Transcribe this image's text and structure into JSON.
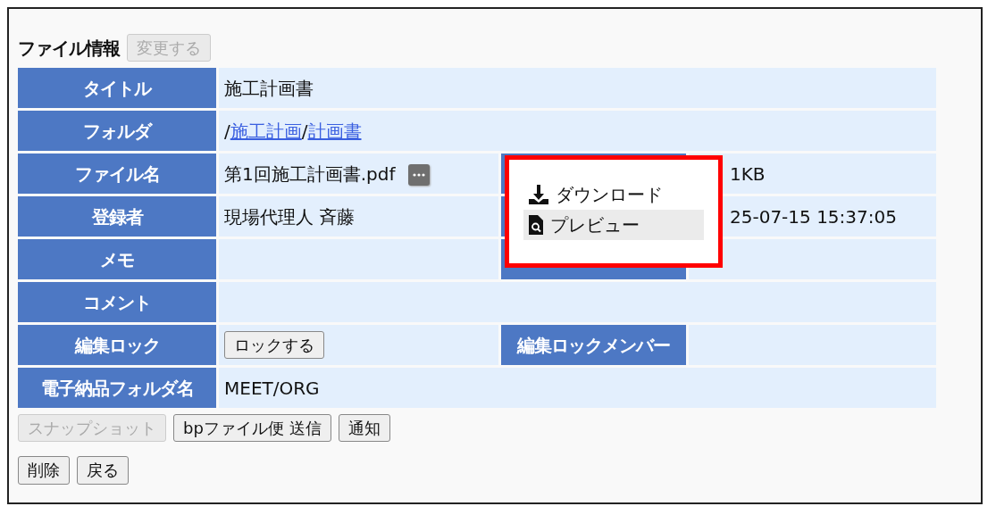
{
  "section": {
    "title": "ファイル情報",
    "edit_button": {
      "label": "変更する",
      "disabled": true
    }
  },
  "rows": [
    {
      "cells": [
        {
          "kind": "head",
          "text": "タイトル"
        },
        {
          "kind": "text",
          "text": "施工計画書"
        }
      ]
    },
    {
      "cells": [
        {
          "kind": "head",
          "text": "フォルダ"
        },
        {
          "kind": "links",
          "separator": "/",
          "links": [
            "施工計画",
            "計画書"
          ]
        }
      ]
    },
    {
      "cells": [
        {
          "kind": "head",
          "text": "ファイル名"
        },
        {
          "kind": "file",
          "text": "第1回施工計画書.pdf"
        },
        {
          "kind": "head"
        },
        {
          "kind": "text",
          "text": "1KB"
        }
      ]
    },
    {
      "cells": [
        {
          "kind": "head",
          "text": "登録者"
        },
        {
          "kind": "text",
          "text": "現場代理人 斉藤"
        },
        {
          "kind": "head"
        },
        {
          "kind": "text",
          "text": "25-07-15 15:37:05"
        }
      ]
    },
    {
      "cells": [
        {
          "kind": "head",
          "text": "メモ"
        },
        {
          "kind": "text"
        },
        {
          "kind": "head"
        },
        {
          "kind": "text"
        }
      ]
    },
    {
      "cells": [
        {
          "kind": "head",
          "text": "コメント"
        },
        {
          "kind": "text"
        }
      ]
    },
    {
      "cells": [
        {
          "kind": "head",
          "text": "編集ロック"
        },
        {
          "kind": "button",
          "text": "ロックする"
        },
        {
          "kind": "head",
          "text": "編集ロックメンバー"
        },
        {
          "kind": "text"
        }
      ]
    },
    {
      "cells": [
        {
          "kind": "head",
          "text": "電子納品フォルダ名"
        },
        {
          "kind": "text",
          "text": "MEET/ORG"
        }
      ]
    }
  ],
  "action_rows": [
    [
      {
        "label": "スナップショット",
        "disabled": true
      },
      {
        "label": "bpファイル便 送信",
        "disabled": false
      },
      {
        "label": "通知",
        "disabled": false
      }
    ],
    [
      {
        "label": "削除",
        "disabled": false
      },
      {
        "label": "戻る",
        "disabled": false
      }
    ]
  ],
  "file_menu": {
    "items": [
      {
        "label": "ダウンロード",
        "kind": "download",
        "selected": false
      },
      {
        "label": "プレビュー",
        "kind": "preview",
        "selected": true
      }
    ]
  }
}
